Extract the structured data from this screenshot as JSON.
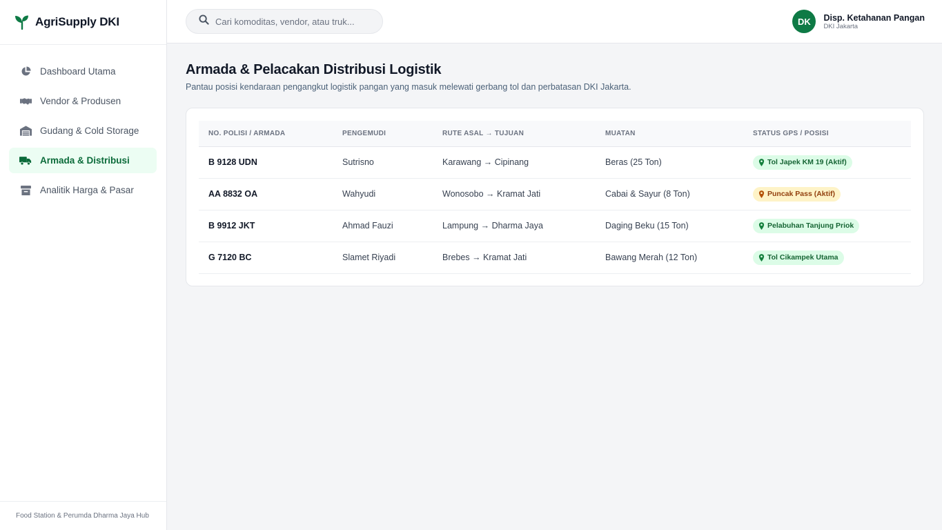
{
  "brand": {
    "name": "AgriSupply DKI",
    "icon": "leaf-icon",
    "color": "#0e7a45"
  },
  "sidebar": {
    "items": [
      {
        "label": "Dashboard Utama",
        "icon": "pie-chart-icon",
        "active": false
      },
      {
        "label": "Vendor & Produsen",
        "icon": "handshake-icon",
        "active": false
      },
      {
        "label": "Gudang & Cold Storage",
        "icon": "warehouse-icon",
        "active": false
      },
      {
        "label": "Armada & Distribusi",
        "icon": "truck-icon",
        "active": true
      },
      {
        "label": "Analitik Harga & Pasar",
        "icon": "store-icon",
        "active": false
      }
    ],
    "footer": "Food Station & Perumda Dharma Jaya Hub"
  },
  "header": {
    "search_placeholder": "Cari komoditas, vendor, atau truk...",
    "user": {
      "initials": "DK",
      "name": "Disp. Ketahanan Pangan",
      "subtitle": "DKI Jakarta"
    }
  },
  "main": {
    "title": "Armada & Pelacakan Distribusi Logistik",
    "subtitle": "Pantau posisi kendaraan pengangkut logistik pangan yang masuk melewati gerbang tol dan perbatasan DKI Jakarta.",
    "table": {
      "columns": [
        "No. Polisi / Armada",
        "Pengemudi",
        "Rute Asal → Tujuan",
        "Muatan",
        "Status GPS / Posisi"
      ],
      "rows": [
        {
          "plate": "B 9128 UDN",
          "driver": "Sutrisno",
          "route": "Karawang → Cipinang",
          "cargo": "Beras (25 Ton)",
          "status": "Tol Japek KM 19 (Aktif)",
          "status_color": "green"
        },
        {
          "plate": "AA 8832 OA",
          "driver": "Wahyudi",
          "route": "Wonosobo → Kramat Jati",
          "cargo": "Cabai & Sayur (8 Ton)",
          "status": "Puncak Pass (Aktif)",
          "status_color": "amber"
        },
        {
          "plate": "B 9912 JKT",
          "driver": "Ahmad Fauzi",
          "route": "Lampung → Dharma Jaya",
          "cargo": "Daging Beku (15 Ton)",
          "status": "Pelabuhan Tanjung Priok",
          "status_color": "green"
        },
        {
          "plate": "G 7120 BC",
          "driver": "Slamet Riyadi",
          "route": "Brebes → Kramat Jati",
          "cargo": "Bawang Merah (12 Ton)",
          "status": "Tol Cikampek Utama",
          "status_color": "green"
        }
      ]
    }
  }
}
